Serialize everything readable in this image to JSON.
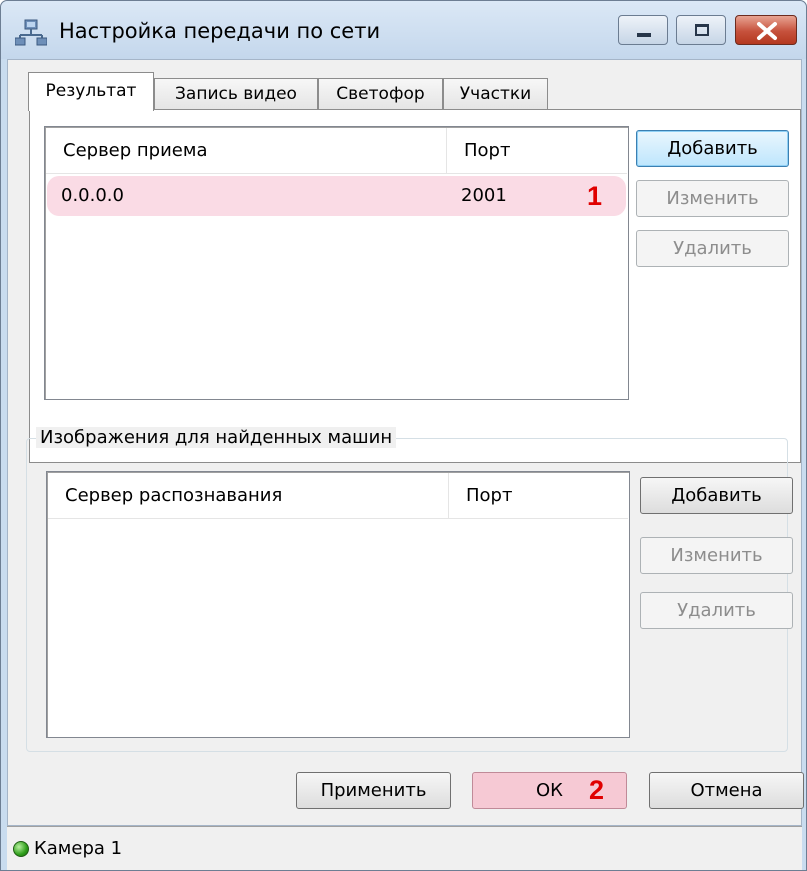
{
  "window": {
    "title": "Настройка передачи по сети"
  },
  "tabs": [
    {
      "label": "Результат",
      "active": true
    },
    {
      "label": "Запись видео",
      "active": false
    },
    {
      "label": "Светофор",
      "active": false
    },
    {
      "label": "Участки",
      "active": false
    }
  ],
  "servers": {
    "columns": [
      "Сервер приема",
      "Порт"
    ],
    "rows": [
      {
        "server": "0.0.0.0",
        "port": "2001"
      }
    ],
    "annotation": "1",
    "buttons": {
      "add": "Добавить",
      "edit": "Изменить",
      "delete": "Удалить"
    }
  },
  "images": {
    "group_title": "Изображения для найденных машин",
    "columns": [
      "Сервер распознавания",
      "Порт"
    ],
    "buttons": {
      "add": "Добавить",
      "edit": "Изменить",
      "delete": "Удалить"
    }
  },
  "footer": {
    "apply": "Применить",
    "ok": "ОК",
    "ok_annotation": "2",
    "cancel": "Отмена"
  },
  "status": {
    "camera": "Камера 1",
    "indicator_color": "#2e9e1a"
  },
  "colors": {
    "highlight": "#fadbe5",
    "annotation": "#e00000",
    "titlebar": "#c9dcef"
  }
}
